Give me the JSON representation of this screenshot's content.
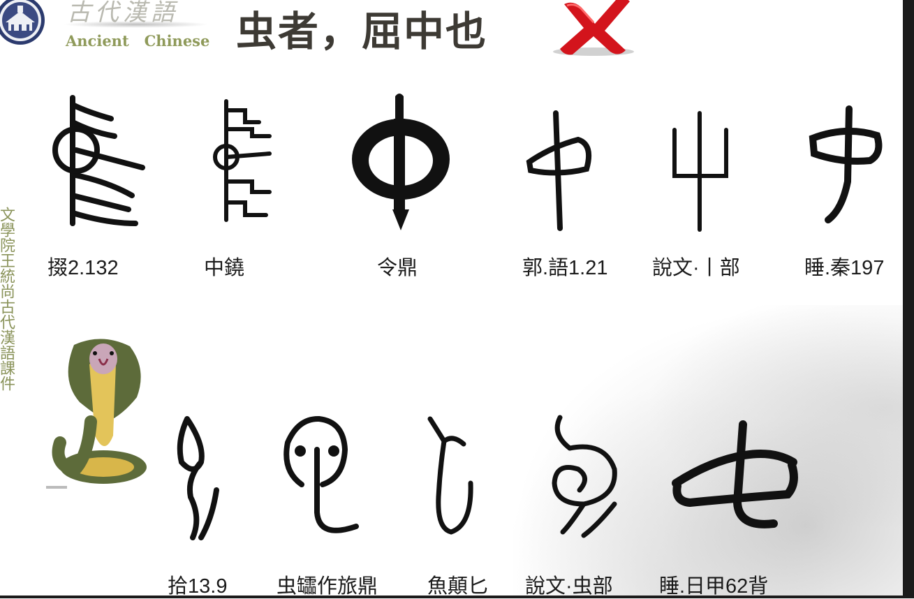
{
  "header": {
    "brand_cn": "古代漢語",
    "brand_en": "Ancient   Chinese",
    "title": "虫者，屈中也"
  },
  "sidebar_text": "文學院王統尚古代漢語課件",
  "row1_captions": [
    "掇2.132",
    "中鐃",
    "令鼎",
    "郭.語1.21",
    "說文·丨部",
    "睡.秦197"
  ],
  "row2_captions": [
    "拾13.9",
    "虫𦉢作旅鼎",
    "魚顛匕",
    "說文·虫部",
    "睡.日甲62背"
  ],
  "icons": {
    "logo": "university-seal-icon",
    "cross": "red-cross-icon",
    "illustration": "cobra-illustration"
  },
  "colors": {
    "title": "#3d3a34",
    "brand_en": "#8f9a5a",
    "sidebar": "#8a935a",
    "cross": "#d3141c",
    "ink": "#111111"
  }
}
